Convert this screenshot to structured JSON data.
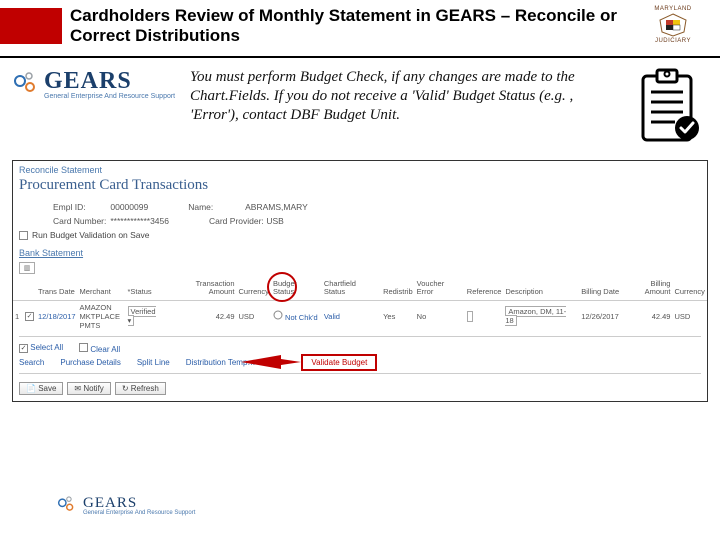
{
  "header": {
    "title": "Cardholders Review of Monthly Statement in GEARS – Reconcile or Correct Distributions",
    "seal_top": "MARYLAND",
    "seal_bottom": "JUDICIARY"
  },
  "logo": {
    "brand": "GEARS",
    "subtitle": "General Enterprise And Resource Support"
  },
  "intro": "You must perform Budget Check, if any changes are made to the Chart.Fields.  If you do not receive a 'Valid' Budget Status (e.g. , 'Error'), contact DBF Budget Unit.",
  "panel": {
    "crumb": "Reconcile Statement",
    "heading": "Procurement Card Transactions",
    "fields": {
      "empl_id_lbl": "Empl ID:",
      "empl_id_val": "00000099",
      "name_lbl": "Name:",
      "name_val": "ABRAMS,MARY",
      "card_number_lbl": "Card Number:",
      "card_number_val": "************3456",
      "card_provider_lbl": "Card Provider:",
      "card_provider_val": "USB",
      "run_budget_lbl": "Run Budget Validation on Save"
    },
    "bank_link": "Bank Statement",
    "grid_tab": "▥",
    "columns": {
      "trans_date": "Trans Date",
      "merchant": "Merchant",
      "status": "*Status",
      "trans_amt": "Transaction Amount",
      "currency": "Currency",
      "budget_status": "Budget Status",
      "chartfield": "Chartfield Status",
      "redistrib": "Redistrib",
      "voucher_error": "Voucher Error",
      "reference": "Reference",
      "description": "Description",
      "billing_date": "Billing Date",
      "billing_amt": "Billing Amount",
      "currency2": "Currency"
    },
    "row": {
      "idx": "1",
      "trans_date": "12/18/2017",
      "merchant": "AMAZON MKTPLACE PMTS",
      "status": "Verified",
      "trans_amt": "42.49",
      "currency": "USD",
      "budget_status": "Not Chk'd",
      "chartfield": "Valid",
      "redistrib": "Yes",
      "voucher_error": "No",
      "reference": "",
      "description": "Amazon, DM, 11-18",
      "billing_date": "12/26/2017",
      "billing_amt": "42.49",
      "currency2": "USD"
    },
    "controls": {
      "select_all": "Select All",
      "clear_all": "Clear All",
      "search": "Search",
      "purchase_details": "Purchase Details",
      "split_line": "Split Line",
      "distribution_temp": "Distribution Temp…",
      "validate": "Validate Budget",
      "save": "Save",
      "notify": "Notify",
      "refresh": "Refresh"
    }
  },
  "footer_logo": {
    "brand": "GEARS",
    "subtitle": "General Enterprise And Resource Support"
  }
}
